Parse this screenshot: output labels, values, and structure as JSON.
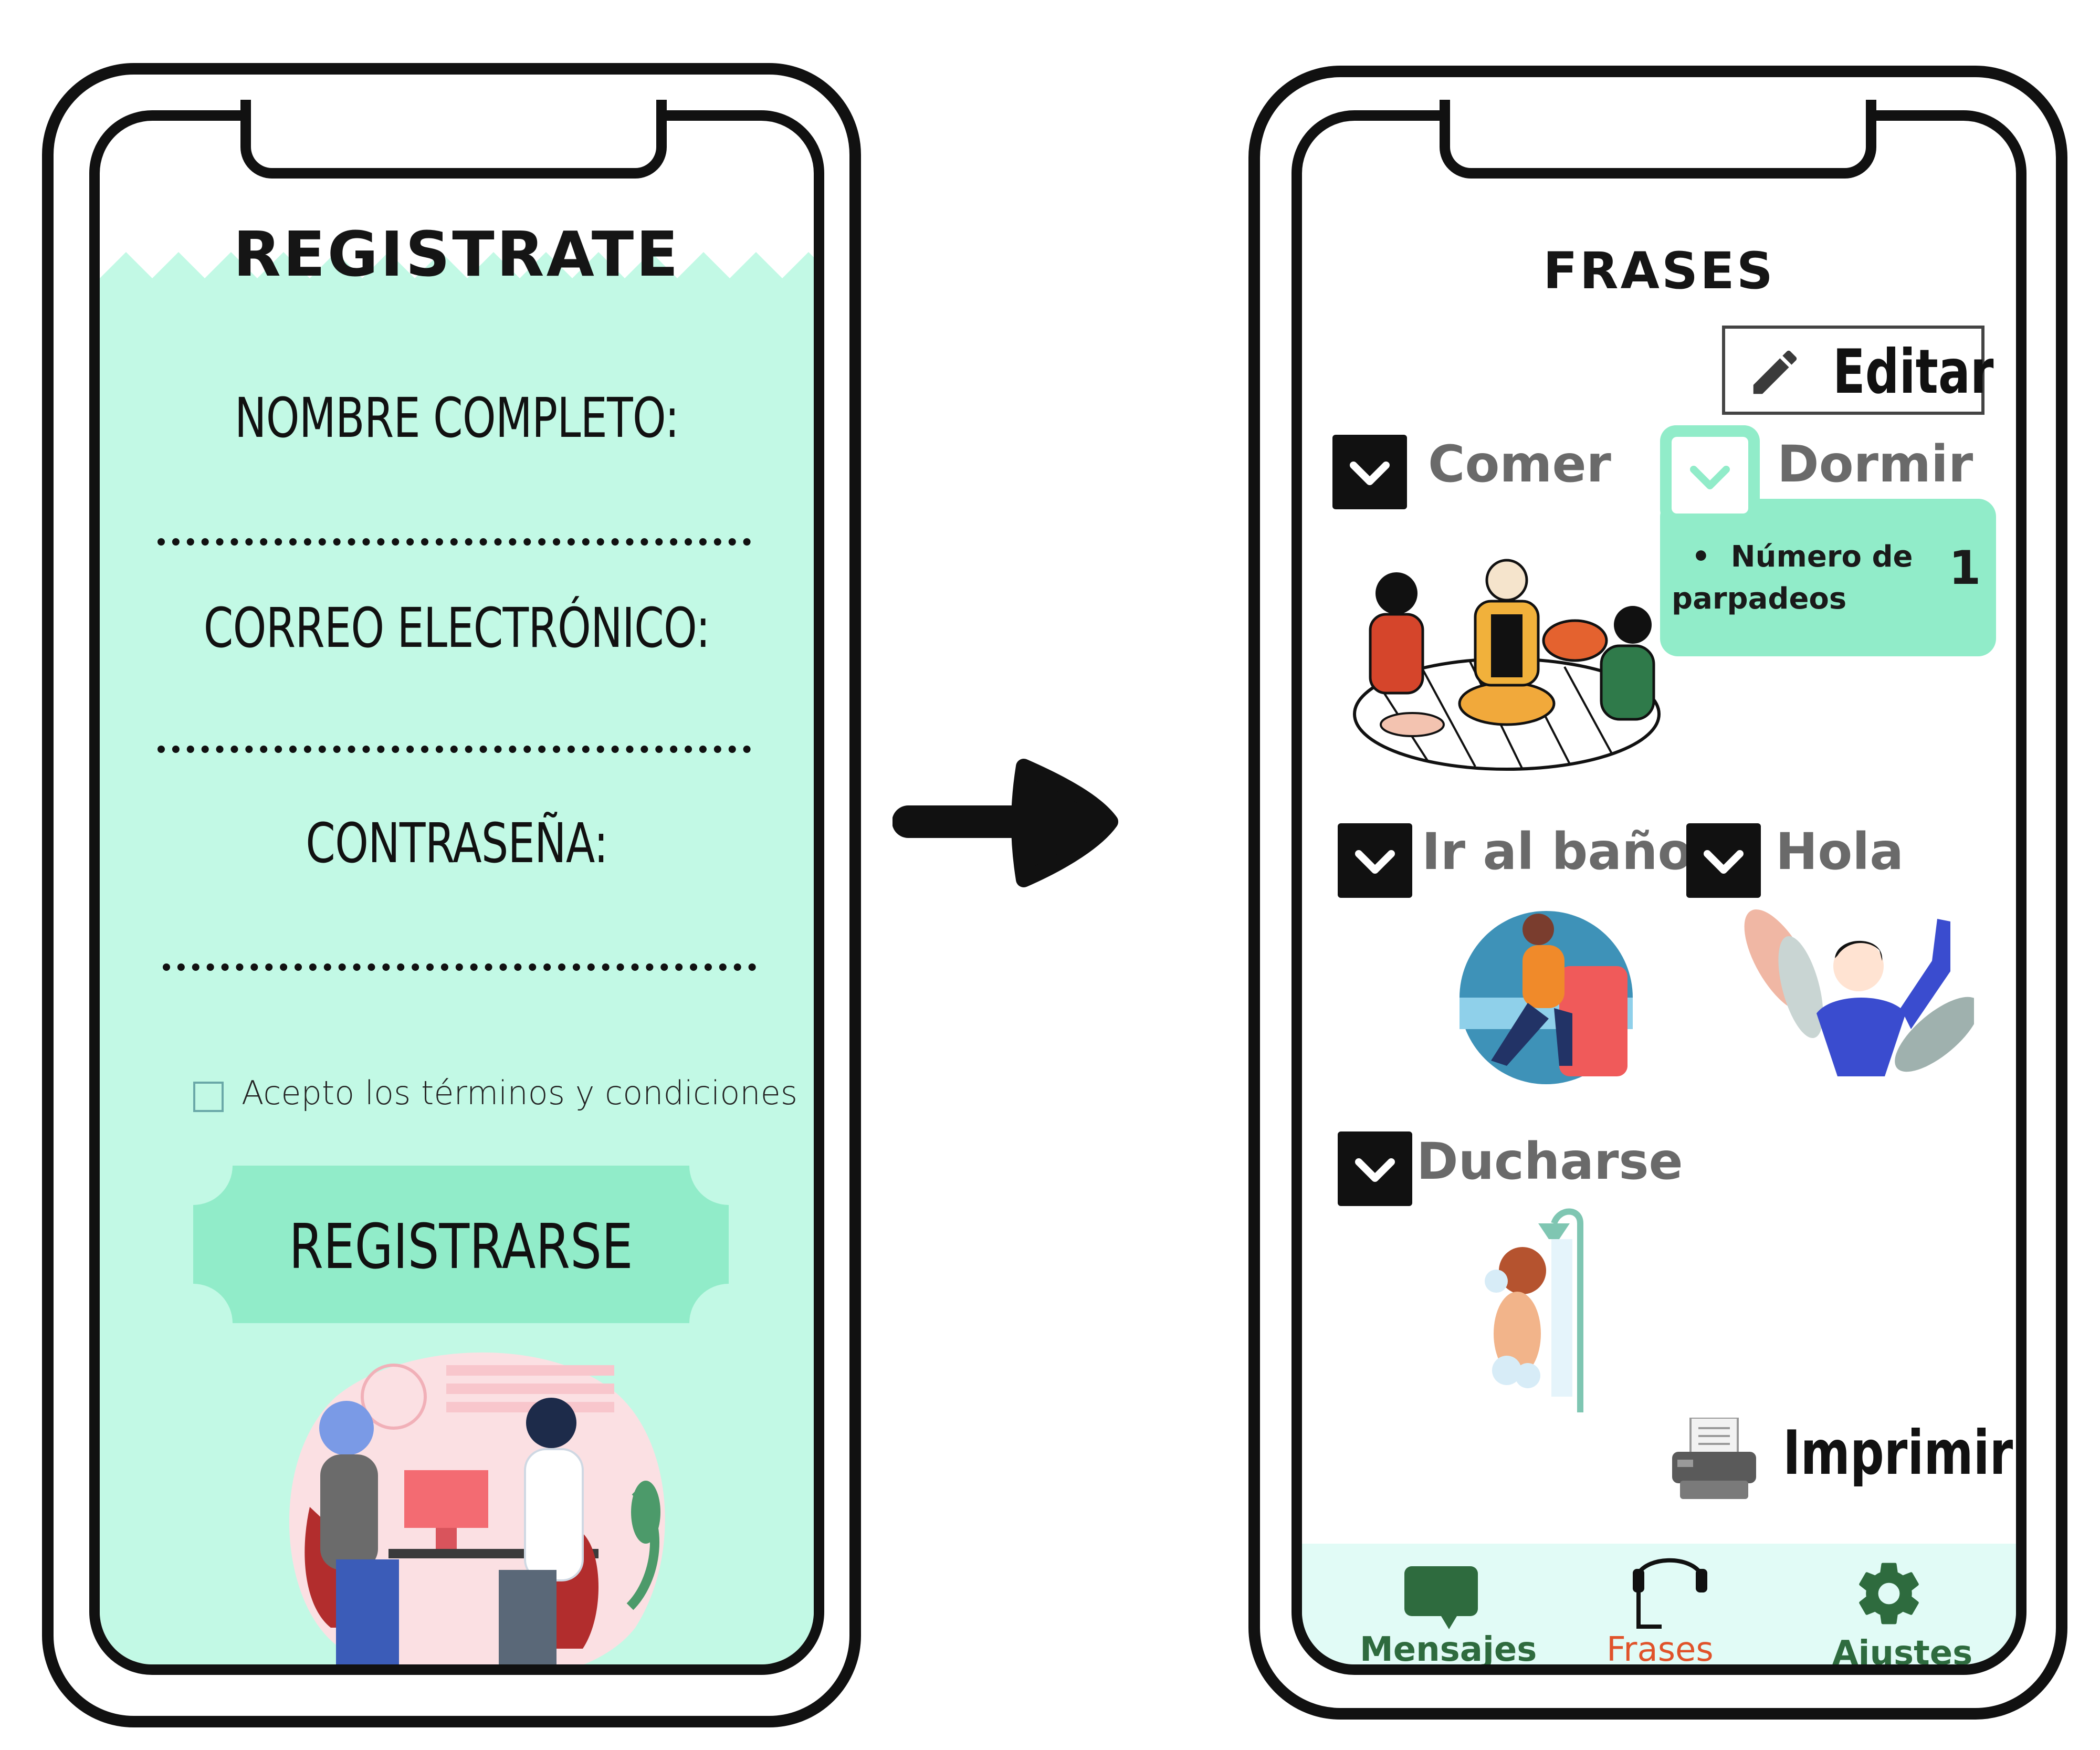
{
  "register": {
    "title": "REGISTRATE",
    "fields": [
      {
        "label": "NOMBRE COMPLETO:"
      },
      {
        "label": "CORREO ELECTRÓNICO:"
      },
      {
        "label": "CONTRASEÑA:"
      }
    ],
    "terms_label": "Acepto los términos y condiciones",
    "submit_label": "REGISTRARSE"
  },
  "phrases": {
    "title": "FRASES",
    "edit_label": "Editar",
    "categories": [
      {
        "label": "Comer"
      },
      {
        "label": "Dormir"
      },
      {
        "label": "Ir al baño"
      },
      {
        "label": "Hola"
      },
      {
        "label": "Ducharse"
      }
    ],
    "dropdown": {
      "item_line1": "Número de",
      "item_line2": "parpadeos",
      "item_count": "1"
    },
    "print_label": "Imprimir",
    "nav": [
      {
        "label": "Mensajes",
        "icon": "chat-icon",
        "color": "#2e6b3e"
      },
      {
        "label": "Frases",
        "icon": "headset-icon",
        "color": "#e0532b"
      },
      {
        "label": "Ajustes",
        "icon": "gear-icon",
        "color": "#2e6b3e"
      }
    ]
  },
  "colors": {
    "mint_light": "#c2f9e5",
    "mint": "#91ecc9",
    "nav_bg": "#e1fbf6",
    "outline": "#111111"
  }
}
